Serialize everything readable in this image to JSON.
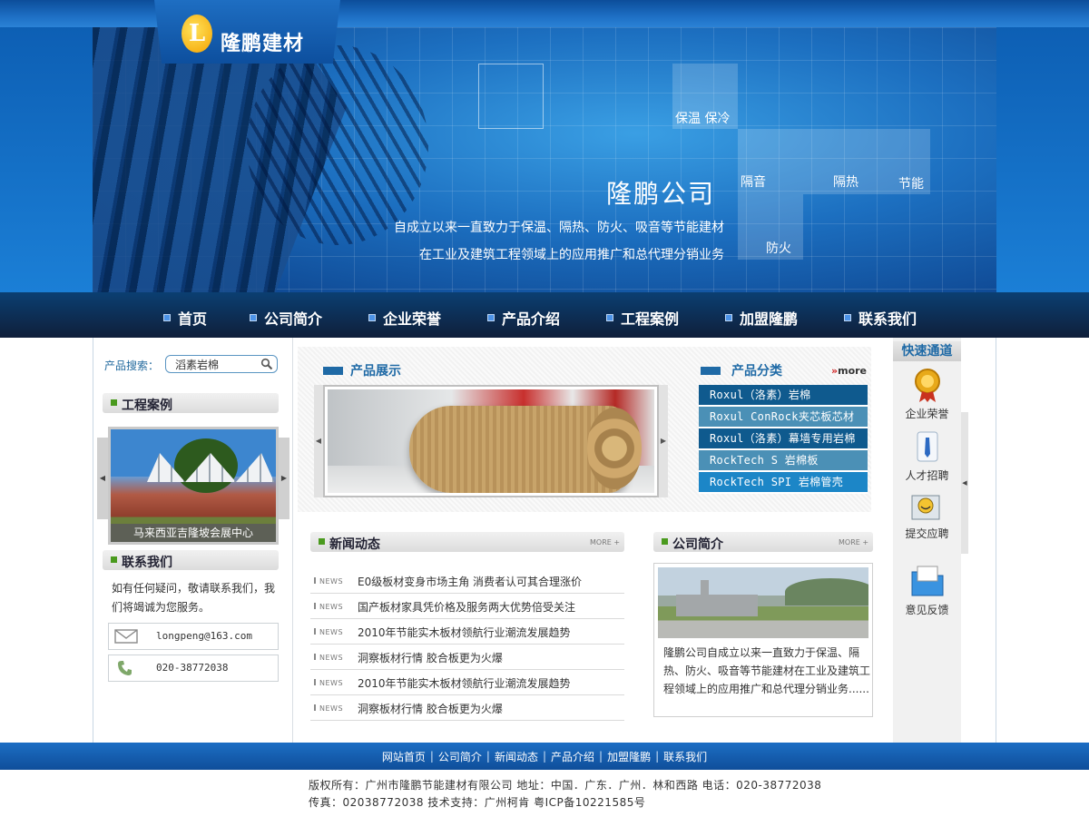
{
  "brand": {
    "name": "隆鹏建材",
    "logo_letter": "L"
  },
  "banner": {
    "title": "隆鹏公司",
    "line1": "自成立以来一直致力于保温、隔热、防火、吸音等节能建材",
    "line2": "在工业及建筑工程领域上的应用推广和总代理分销业务",
    "tags": {
      "insulation": "保温 保冷",
      "sound": "隔音",
      "heat": "隔热",
      "energy": "节能",
      "fire": "防火"
    }
  },
  "nav": {
    "items": [
      "首页",
      "公司简介",
      "企业荣誉",
      "产品介绍",
      "工程案例",
      "加盟隆鹏",
      "联系我们"
    ]
  },
  "search": {
    "label": "产品搜索：",
    "value": "滔素岩棉"
  },
  "cases": {
    "title": "工程案例",
    "caption": "马来西亚吉隆坡会展中心"
  },
  "contact": {
    "title": "联系我们",
    "text": "如有任何疑问，敬请联系我们，我们将竭诚为您服务。",
    "email": "longpeng@163.com",
    "phone": "020-38772038"
  },
  "products": {
    "title": "产品展示"
  },
  "categories": {
    "title": "产品分类",
    "more": "more",
    "items": [
      "Roxul（洛素）岩棉",
      "Roxul ConRock夹芯板芯材",
      "Roxul（洛素）幕墙专用岩棉",
      "RockTech S 岩棉板",
      "RockTech SPI 岩棉管壳"
    ],
    "colors": [
      "#0f5a8e",
      "#4b90b6",
      "#0f5a8e",
      "#4b90b6",
      "#1c86c7"
    ]
  },
  "news": {
    "title": "新闻动态",
    "more": "MORE +",
    "tag": "NEWS",
    "items": [
      "E0级板材变身市场主角 消费者认可其合理涨价",
      "国产板材家具凭价格及服务两大优势倍受关注",
      "2010年节能实木板材领航行业潮流发展趋势",
      "洞察板材行情 胶合板更为火爆",
      "2010年节能实木板材领航行业潮流发展趋势",
      "洞察板材行情 胶合板更为火爆"
    ]
  },
  "company": {
    "title": "公司简介",
    "more": "MORE +",
    "text": "隆鹏公司自成立以来一直致力于保温、隔热、防火、吸音等节能建材在工业及建筑工程领域上的应用推广和总代理分销业务......"
  },
  "quick": {
    "title": "快速通道",
    "items": [
      "企业荣誉",
      "人才招聘",
      "提交应聘",
      "意见反馈"
    ]
  },
  "footer": {
    "links": [
      "网站首页",
      "公司简介",
      "新闻动态",
      "产品介绍",
      "加盟隆鹏",
      "联系我们"
    ],
    "separator": "|",
    "copyright": "版权所有：广州市隆鹏节能建材有限公司 地址：中国．广东．广州．林和西路 电话：020-38772038",
    "fax": "传真：02038772038 技术支持：广州柯肯 粤ICP备10221585号"
  },
  "colors": {
    "brand_blue": "#1f6aa6",
    "accent_green": "#4a9a1e",
    "nav_dark": "#0f1f3a"
  }
}
